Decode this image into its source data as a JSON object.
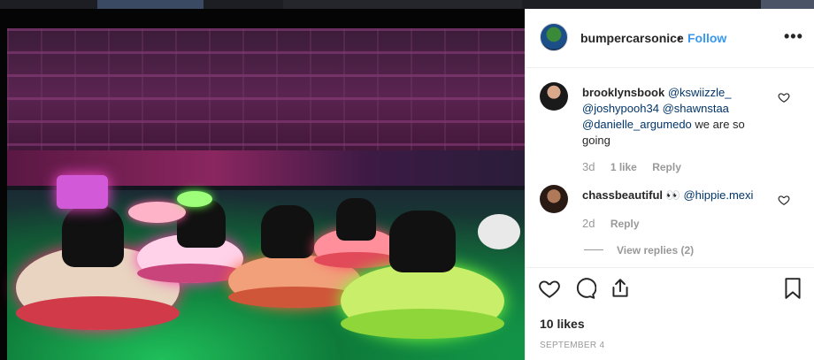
{
  "post": {
    "author": "bumpercarsonice",
    "follow_label": "Follow",
    "separator": "•",
    "more_label": "•••",
    "likes_text": "10 likes",
    "date_text": "SEPTEMBER 4"
  },
  "comments": [
    {
      "username": "brooklynsbook",
      "mentions": [
        "@kswiizzle_",
        "@joshypooh34",
        "@shawnstaa",
        "@danielle_argumedo"
      ],
      "text": "we are so going",
      "ago": "3d",
      "likes": "1 like",
      "reply_label": "Reply"
    },
    {
      "username": "chassbeautiful",
      "emoji": "👀",
      "mentions": [
        "@hippie.mexi"
      ],
      "ago": "2d",
      "reply_label": "Reply",
      "view_replies_label": "View replies (2)"
    }
  ],
  "icons": {
    "heart": "heart-outline-icon",
    "comment": "comment-bubble-icon",
    "share": "share-icon",
    "save": "bookmark-icon"
  },
  "colors": {
    "link": "#003569",
    "follow": "#3897f0",
    "muted": "#999999"
  }
}
